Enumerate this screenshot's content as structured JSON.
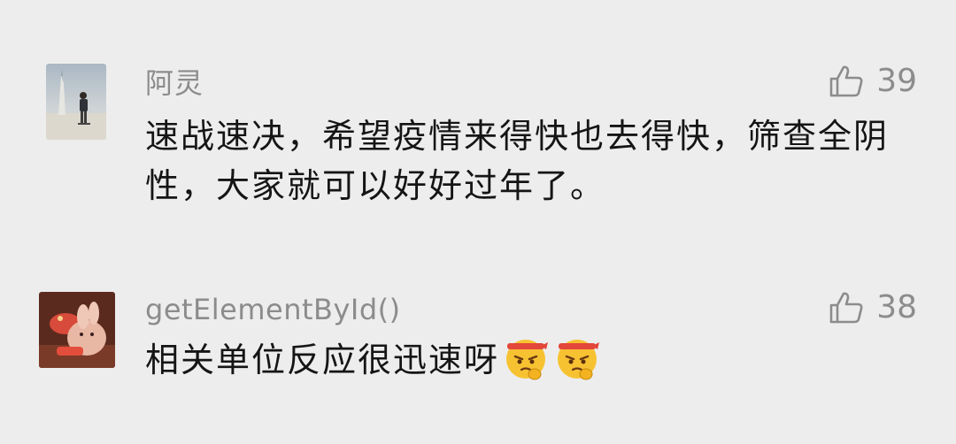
{
  "comments": [
    {
      "author": "阿灵",
      "text": "速战速决，希望疫情来得快也去得快，筛查全阴性，大家就可以好好过年了。",
      "likes": "39",
      "avatar": "photo-avatar",
      "like_icon": "thumbs-up-icon"
    },
    {
      "author": "getElementById()",
      "text": "相关单位反应很迅速呀",
      "likes": "38",
      "avatar": "cartoon-avatar",
      "like_icon": "thumbs-up-icon",
      "emojis": [
        "determined-emoji",
        "determined-emoji"
      ]
    }
  ],
  "colors": {
    "background": "#ededed",
    "author": "#8c8c8c",
    "text": "#151515",
    "like": "#8c8c8c"
  }
}
